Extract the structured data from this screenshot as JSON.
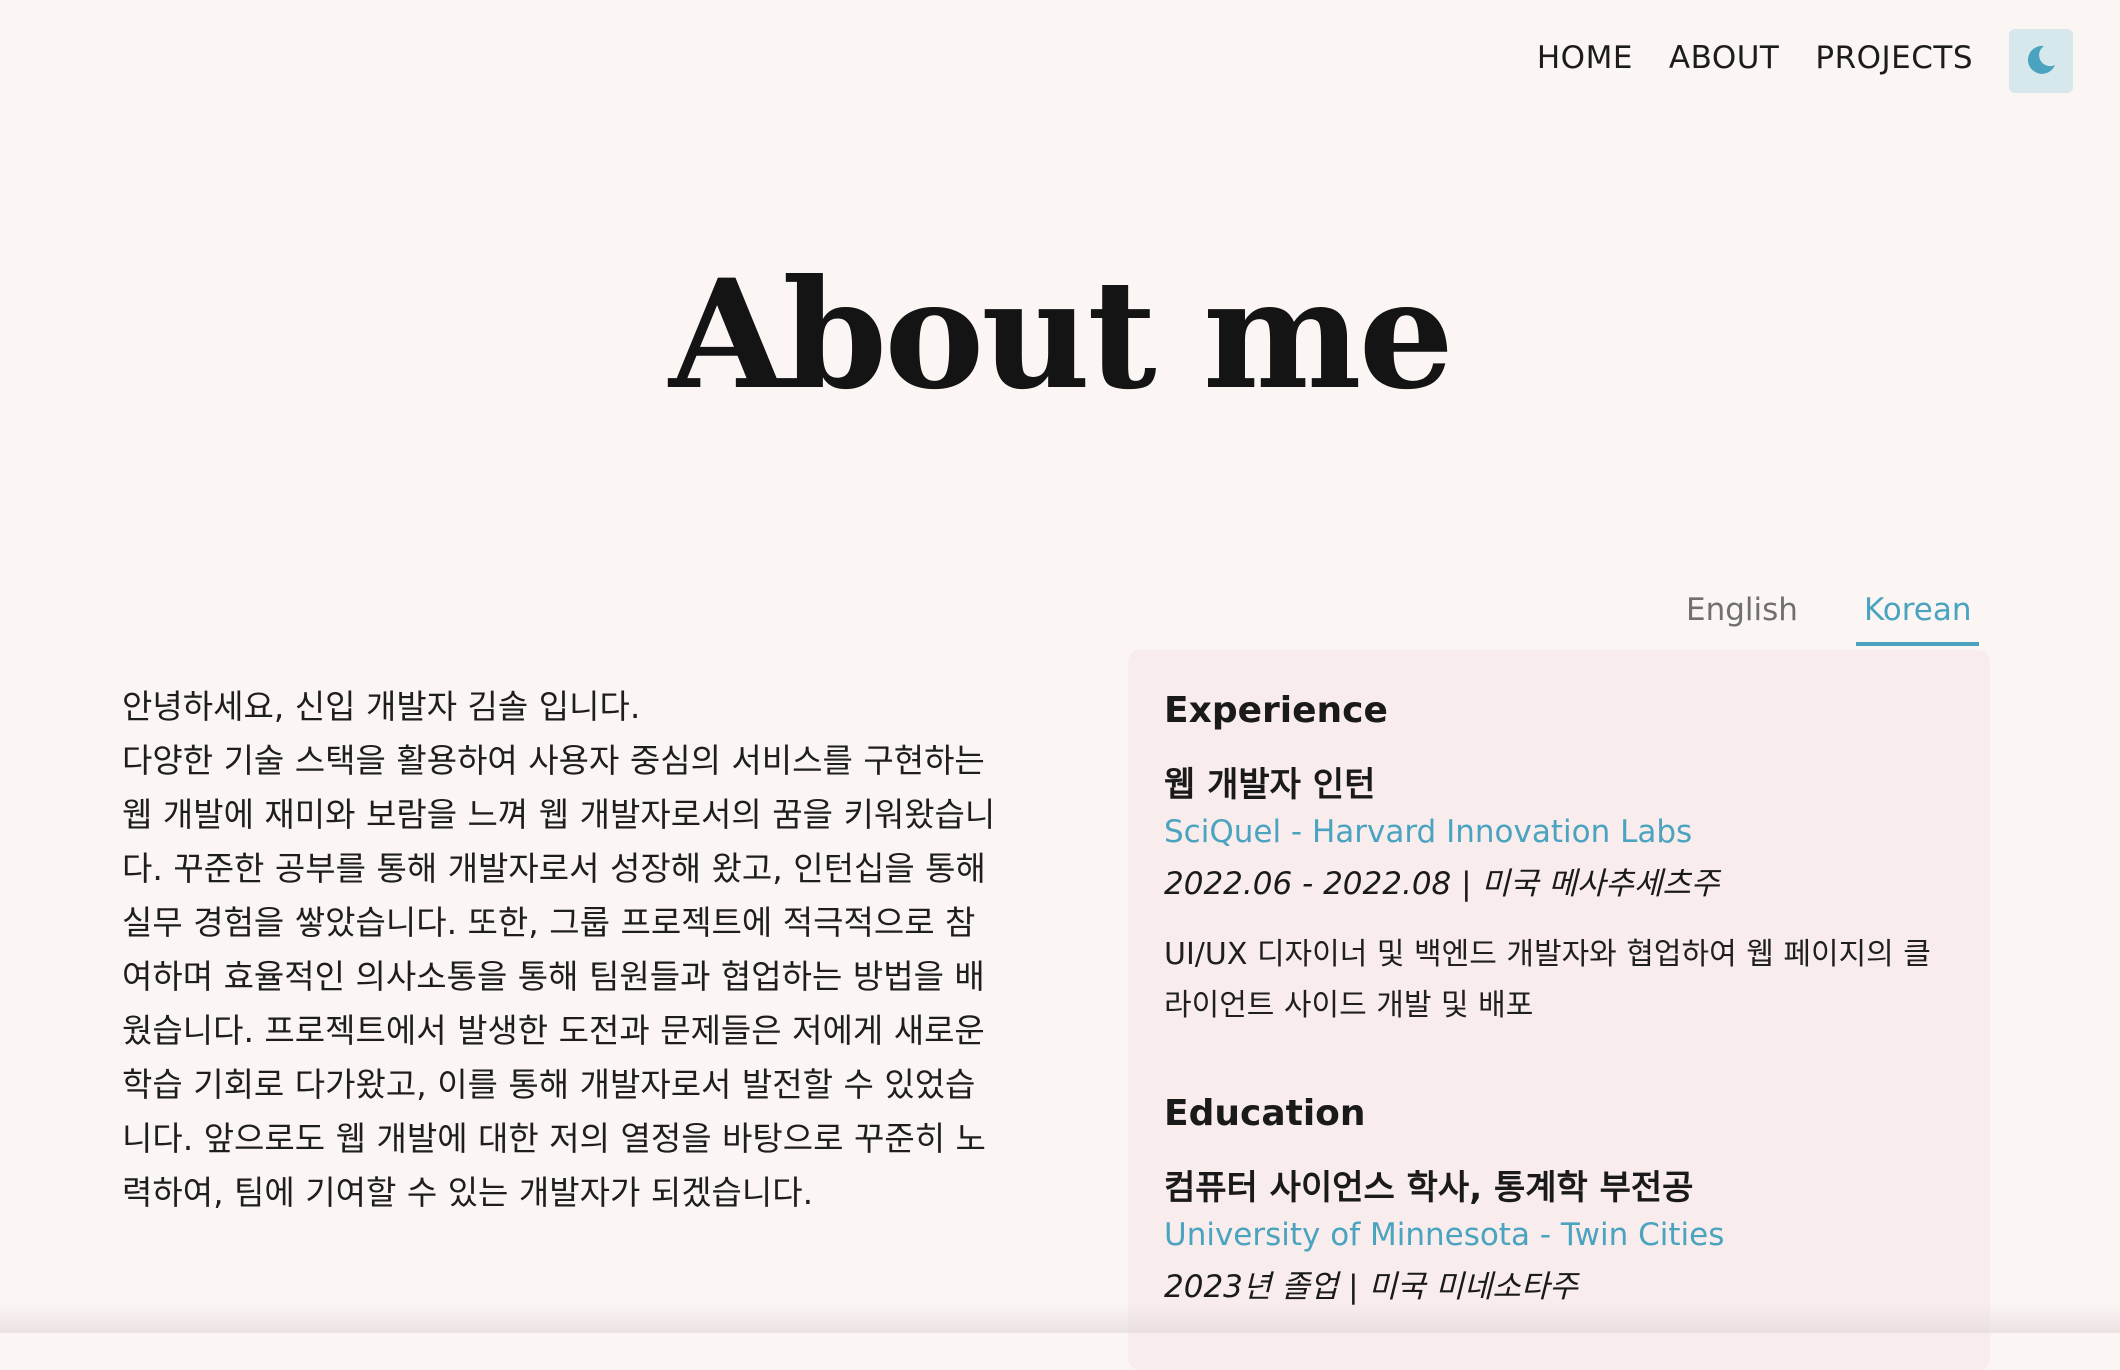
{
  "nav": {
    "links": [
      "HOME",
      "ABOUT",
      "PROJECTS"
    ],
    "theme_toggle_icon": "moon-icon",
    "accent_color": "#4aa3bf"
  },
  "page": {
    "title": "About me"
  },
  "bio": {
    "greeting": "안녕하세요, 신입 개발자 김솔 입니다.",
    "body": "다양한 기술 스택을 활용하여 사용자 중심의 서비스를 구현하는 웹 개발에 재미와 보람을 느껴 웹 개발자로서의 꿈을 키워왔습니다. 꾸준한 공부를 통해 개발자로서 성장해 왔고, 인턴십을 통해 실무 경험을 쌓았습니다. 또한, 그룹 프로젝트에 적극적으로 참여하며 효율적인 의사소통을 통해 팀원들과 협업하는 방법을 배웠습니다. 프로젝트에서 발생한 도전과 문제들은 저에게 새로운 학습 기회로 다가왔고, 이를 통해 개발자로서 발전할 수 있었습니다. 앞으로도 웹 개발에 대한 저의 열정을 바탕으로 꾸준히 노력하여, 팀에 기여할 수 있는 개발자가 되겠습니다."
  },
  "tabs": {
    "items": [
      "English",
      "Korean"
    ],
    "selected": "Korean"
  },
  "experience": {
    "heading": "Experience",
    "role": "웹 개발자 인턴",
    "organization": "SciQuel - Harvard Innovation Labs",
    "dates": "2022.06 - 2022.08 | 미국 메사추세츠주",
    "description": "UI/UX 디자이너 및 백엔드 개발자와 협업하여 웹 페이지의 클라이언트 사이드 개발 및 배포"
  },
  "education": {
    "heading": "Education",
    "degree": "컴퓨터 사이언스 학사, 통계학 부전공",
    "school": "University of Minnesota - Twin Cities",
    "dates": "2023년 졸업 | 미국 미네소타주"
  }
}
